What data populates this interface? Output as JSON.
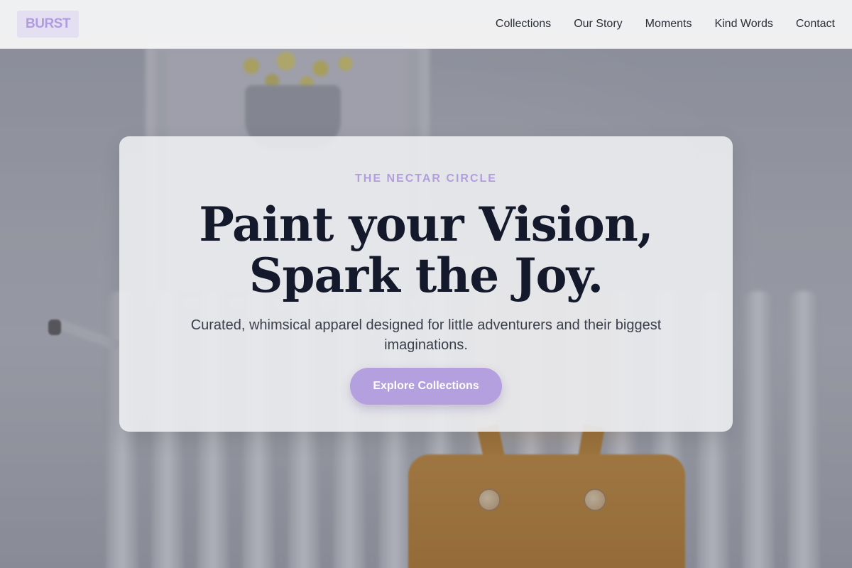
{
  "brand": {
    "logo_text": "BURST",
    "accent_color": "#b49fdf"
  },
  "nav": {
    "links": [
      "Collections",
      "Our Story",
      "Moments",
      "Kind Words",
      "Contact"
    ]
  },
  "hero": {
    "eyebrow": "THE NECTAR CIRCLE",
    "headline_line1": "Paint your Vision,",
    "headline_line2": "Spark the Joy.",
    "subtitle": "Curated, whimsical apparel designed for little adventurers and their biggest imaginations.",
    "cta_label": "Explore Collections"
  },
  "icons": [
    "hero-background-photo"
  ]
}
